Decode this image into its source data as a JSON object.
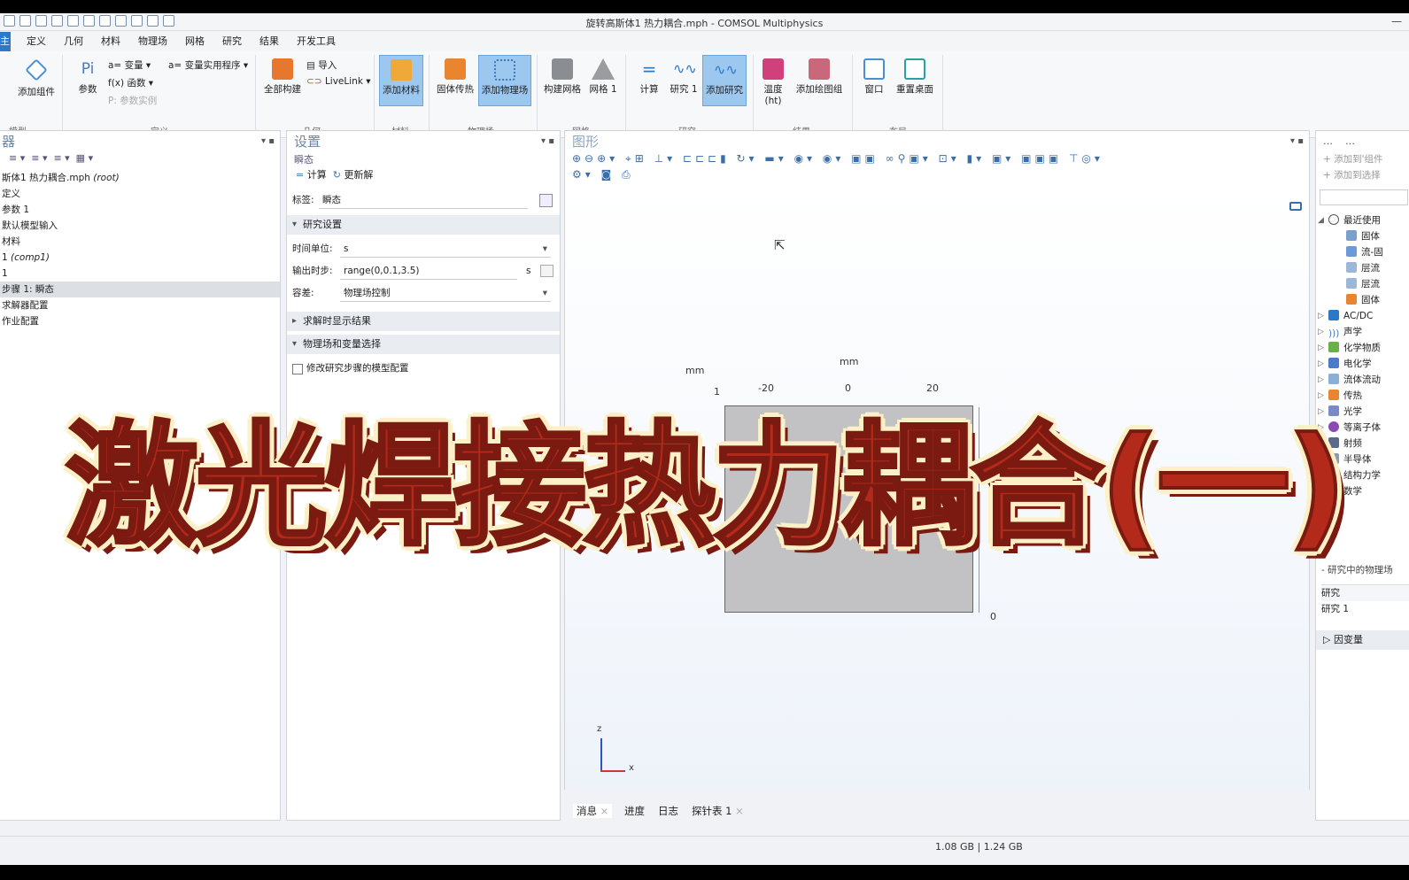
{
  "window": {
    "title": "旋转高斯体1 热力耦合.mph - COMSOL Multiphysics"
  },
  "menu": [
    "主屏幕",
    "定义",
    "几何",
    "材料",
    "物理场",
    "网格",
    "研究",
    "结果",
    "开发工具"
  ],
  "ribbon": {
    "model": {
      "add_component": "添加组件",
      "group": "模型"
    },
    "definitions": {
      "params": "参数",
      "variables": "变量",
      "functions": "函数",
      "param_case": "参数实例",
      "var_utils": "变量实用程序",
      "group": "定义"
    },
    "geometry": {
      "build_all": "全部构建",
      "import": "导入",
      "livelink": "LiveLink",
      "group": "几何"
    },
    "materials": {
      "add_material": "添加材料",
      "group": "材料"
    },
    "physics": {
      "solid_heat": "固体传热",
      "add_physics": "添加物理场",
      "group": "物理场"
    },
    "mesh": {
      "build_mesh": "构建网格",
      "mesh1": "网格 1",
      "group": "网格"
    },
    "study": {
      "compute": "计算",
      "study1": "研究 1",
      "add_study": "添加研究",
      "group": "研究"
    },
    "results": {
      "temperature": "温度 (ht)",
      "add_plot_group": "添加绘图组",
      "group": "结果"
    },
    "layout": {
      "windows": "窗口",
      "reset_desktop": "重置桌面",
      "group": "布局"
    }
  },
  "model_builder": {
    "title": "器",
    "tree": [
      "斯体1 热力耦合.mph",
      "(root)",
      "定义",
      "参数 1",
      "默认模型输入",
      "材料",
      "1",
      "(comp1)",
      "1",
      "步骤 1: 瞬态",
      "求解器配置",
      "作业配置"
    ]
  },
  "settings": {
    "title": "设置",
    "subtitle": "瞬态",
    "compute": "计算",
    "update": "更新解",
    "label_caption": "标签:",
    "label_value": "瞬态",
    "section_study": "研究设置",
    "time_unit_caption": "时间单位:",
    "time_unit": "s",
    "output_caption": "输出时步:",
    "output_value": "range(0,0.1,3.5)",
    "output_unit": "s",
    "tolerance_caption": "容差:",
    "tolerance": "物理场控制",
    "section_results": "求解时显示结果",
    "section_physics": "物理场和变量选择",
    "modify_checkbox": "修改研究步骤的模型配置"
  },
  "graphics": {
    "title": "图形",
    "unit_top": "mm",
    "unit_left": "mm",
    "x_ticks": [
      "-20",
      "0",
      "20"
    ],
    "y_tick_top": "1",
    "y_tick_bottom": "0",
    "axis_z": "z",
    "axis_x": "x"
  },
  "bottom_tabs": [
    "消息",
    "进度",
    "日志",
    "探针表 1"
  ],
  "status": {
    "memory": "1.08 GB | 1.24 GB"
  },
  "physics_library": {
    "add_to_component": "添加到'组件",
    "add_to_selection": "添加到选择",
    "recent": "最近使用",
    "recent_items": [
      "固体",
      "流-固",
      "层流",
      "层流",
      "固体"
    ],
    "categories": [
      "AC/DC",
      "声学",
      "化学物质",
      "电化学",
      "流体流动",
      "传热",
      "光学",
      "等离子体",
      "射频",
      "半导体",
      "结构力学",
      "数学"
    ],
    "study_physics": "研究中的物理场",
    "study_col": "研究",
    "study1": "研究 1",
    "dependent_vars": "因变量"
  },
  "overlay_title": "激光焊接热力耦合(一)",
  "colors": {
    "accent": "#2f78c8",
    "ribbon_selected": "#9cc7ee",
    "overlay_text": "#b32a1a",
    "overlay_outline": "#fdf0c6"
  }
}
